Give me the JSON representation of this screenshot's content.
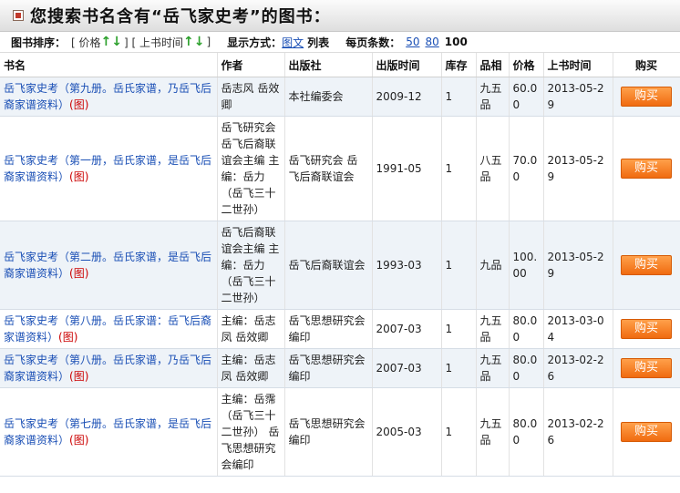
{
  "header": {
    "title": "您搜索书名含有“岳飞家史考”的图书："
  },
  "toolbar": {
    "sort_label": "图书排序：",
    "sort_price": "[ 价格",
    "sort_sep": "] [ 上书时间",
    "sort_end": "]",
    "display_label": "显示方式：",
    "display_image": "图文",
    "display_list": "列表",
    "perpage_label": "每页条数：",
    "perpage_options": [
      "50",
      "80"
    ],
    "perpage_current": "100"
  },
  "table": {
    "headers": [
      "书名",
      "作者",
      "出版社",
      "出版时间",
      "库存",
      "品相",
      "价格",
      "上书时间",
      "购买"
    ],
    "image_tag": "(图)",
    "buy_label": "购买",
    "rows": [
      {
        "title": "岳飞家史考（第九册。岳氏家谱，乃岳飞后裔家谱资料）",
        "author": "岳志风 岳效卿",
        "publisher": "本社编委会",
        "date": "2009-12",
        "stock": "1",
        "condition": "九五品",
        "price": "60.00",
        "listed": "2013-05-29"
      },
      {
        "title": "岳飞家史考（第一册，岳氏家谱，是岳飞后裔家谱资料）",
        "author": "岳飞研究会 岳飞后裔联谊会主编 主编：岳力（岳飞三十二世孙）",
        "publisher": "岳飞研究会 岳飞后裔联谊会",
        "date": "1991-05",
        "stock": "1",
        "condition": "八五品",
        "price": "70.00",
        "listed": "2013-05-29"
      },
      {
        "title": "岳飞家史考（第二册。岳氏家谱，是岳飞后裔家谱资料）",
        "author": "岳飞后裔联谊会主编 主编：岳力（岳飞三十二世孙）",
        "publisher": "岳飞后裔联谊会",
        "date": "1993-03",
        "stock": "1",
        "condition": "九品",
        "price": "100.00",
        "listed": "2013-05-29"
      },
      {
        "title": "岳飞家史考（第八册。岳氏家谱：岳飞后裔家谱资料）",
        "author": "主编：岳志凤 岳效卿",
        "publisher": "岳飞思想研究会编印",
        "date": "2007-03",
        "stock": "1",
        "condition": "九五品",
        "price": "80.00",
        "listed": "2013-03-04"
      },
      {
        "title": "岳飞家史考（第八册。岳氏家谱，乃岳飞后裔家谱资料）",
        "author": "主编：岳志凤 岳效卿",
        "publisher": "岳飞思想研究会编印",
        "date": "2007-03",
        "stock": "1",
        "condition": "九五品",
        "price": "80.00",
        "listed": "2013-02-26"
      },
      {
        "title": "岳飞家史考（第七册。岳氏家谱，是岳飞后裔家谱资料）",
        "author": "主编：岳霈（岳飞三十二世孙） 岳飞思想研究会编印",
        "publisher": "岳飞思想研究会编印",
        "date": "2005-03",
        "stock": "1",
        "condition": "九五品",
        "price": "80.00",
        "listed": "2013-02-26"
      }
    ]
  }
}
